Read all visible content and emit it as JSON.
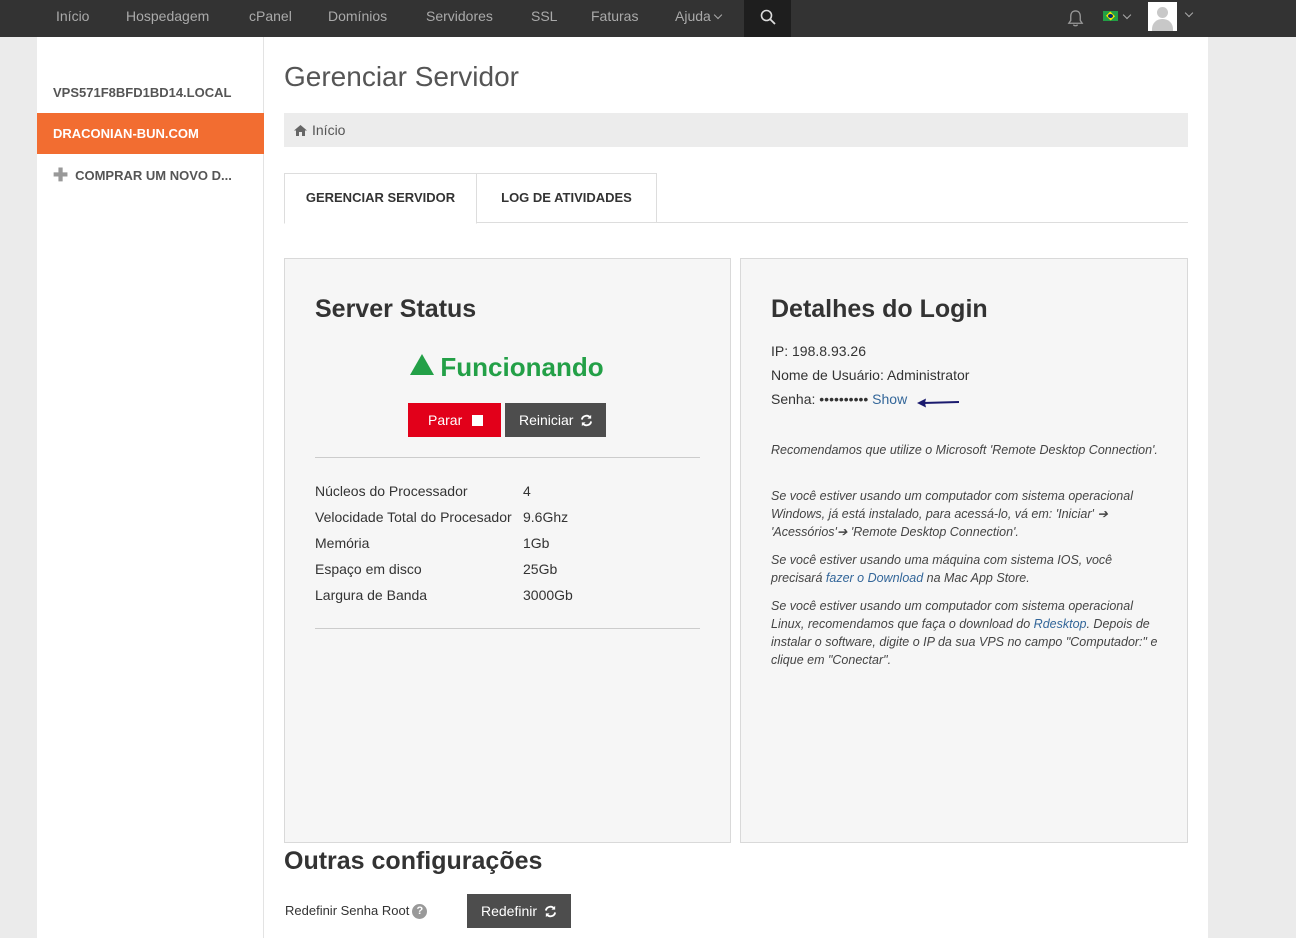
{
  "nav": {
    "items": [
      "Início",
      "Hospedagem",
      "cPanel",
      "Domínios",
      "Servidores",
      "SSL",
      "Faturas"
    ],
    "help_label": "Ajuda",
    "icons": {
      "search": "search-icon",
      "notifications": "bell-icon",
      "language": "brazil-flag-icon",
      "account": "user-avatar"
    }
  },
  "sidebar": {
    "items": [
      {
        "label": "VPS571F8BFD1BD14.LOCAL",
        "active": false
      },
      {
        "label": "DRACONIAN-BUN.COM",
        "active": true
      },
      {
        "label": "COMPRAR UM NOVO D...",
        "active": false
      }
    ]
  },
  "main": {
    "title": "Gerenciar Servidor",
    "breadcrumb": "Início",
    "tabs": [
      {
        "label": "GERENCIAR SERVIDOR",
        "active": true
      },
      {
        "label": "LOG DE ATIVIDADES",
        "active": false
      }
    ]
  },
  "server_status": {
    "title": "Server Status",
    "state": "Funcionando",
    "stop_label": "Parar",
    "restart_label": "Reiniciar",
    "specs": [
      {
        "label": "Núcleos do Processador",
        "value": "4"
      },
      {
        "label": "Velocidade Total do Procesador",
        "value": "9.6Ghz"
      },
      {
        "label": "Memória",
        "value": "1Gb"
      },
      {
        "label": "Espaço em disco",
        "value": "25Gb"
      },
      {
        "label": "Largura de Banda",
        "value": "3000Gb"
      }
    ]
  },
  "login": {
    "title": "Detalhes do Login",
    "ip_label": "IP:",
    "ip": "198.8.93.26",
    "user_label": "Nome de Usuário:",
    "user": "Administrator",
    "password_label": "Senha:",
    "password_mask": "••••••••••",
    "show_label": "Show",
    "notes": {
      "n1": "Recomendamos que utilize o Microsoft 'Remote Desktop Connection'.",
      "n2": "Se você estiver usando um computador com sistema operacional Windows, já está instalado, para acessá-lo, vá em: 'Iniciar' ➔ 'Acessórios'➔ 'Remote Desktop Connection'.",
      "n3_pre": "Se você estiver usando uma máquina com sistema IOS, você precisará ",
      "n3_link": "fazer o Download",
      "n3_post": " na Mac App Store.",
      "n4_pre": "Se você estiver usando um computador com sistema operacional Linux, recomendamos que faça o download do ",
      "n4_link": "Rdesktop",
      "n4_post": ". Depois de instalar o software, digite o IP da sua VPS no campo \"Computador:\" e clique em \"Conectar\"."
    }
  },
  "other": {
    "title": "Outras configurações",
    "reset_root_label": "Redefinir Senha Root",
    "reset_button": "Redefinir"
  },
  "colors": {
    "topbar": "#333333",
    "accent": "#f26d31",
    "status_ok": "#23a047",
    "stop": "#e2001a",
    "dark_button": "#4d4d4d",
    "link": "#336699"
  }
}
